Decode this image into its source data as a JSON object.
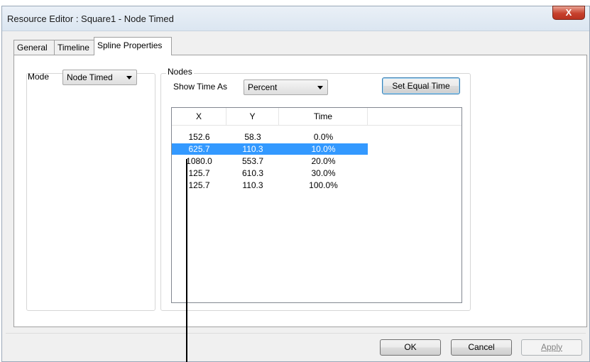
{
  "window": {
    "title": "Resource Editor  :  Square1 - Node Timed",
    "close_glyph": "X"
  },
  "tabs": [
    {
      "label": "General"
    },
    {
      "label": "Timeline"
    },
    {
      "label": "Spline Properties",
      "active": true
    }
  ],
  "mode": {
    "label": "Mode",
    "value": "Node Timed"
  },
  "nodes": {
    "legend": "Nodes",
    "show_time_label": "Show Time As",
    "show_time_value": "Percent",
    "set_equal_time_label": "Set Equal Time",
    "columns": [
      "X",
      "Y",
      "Time"
    ],
    "rows": [
      {
        "x": "152.6",
        "y": "58.3",
        "time": "0.0%"
      },
      {
        "x": "625.7",
        "y": "110.3",
        "time": "10.0%",
        "selected": true
      },
      {
        "x": "1080.0",
        "y": "553.7",
        "time": "20.0%"
      },
      {
        "x": "125.7",
        "y": "610.3",
        "time": "30.0%"
      },
      {
        "x": "125.7",
        "y": "110.3",
        "time": "100.0%"
      }
    ]
  },
  "buttons": {
    "ok": "OK",
    "cancel": "Cancel",
    "apply": "Apply"
  },
  "colors": {
    "selection": "#3399ff",
    "window_border": "#9aa8b8",
    "close_button": "#c7412d"
  }
}
